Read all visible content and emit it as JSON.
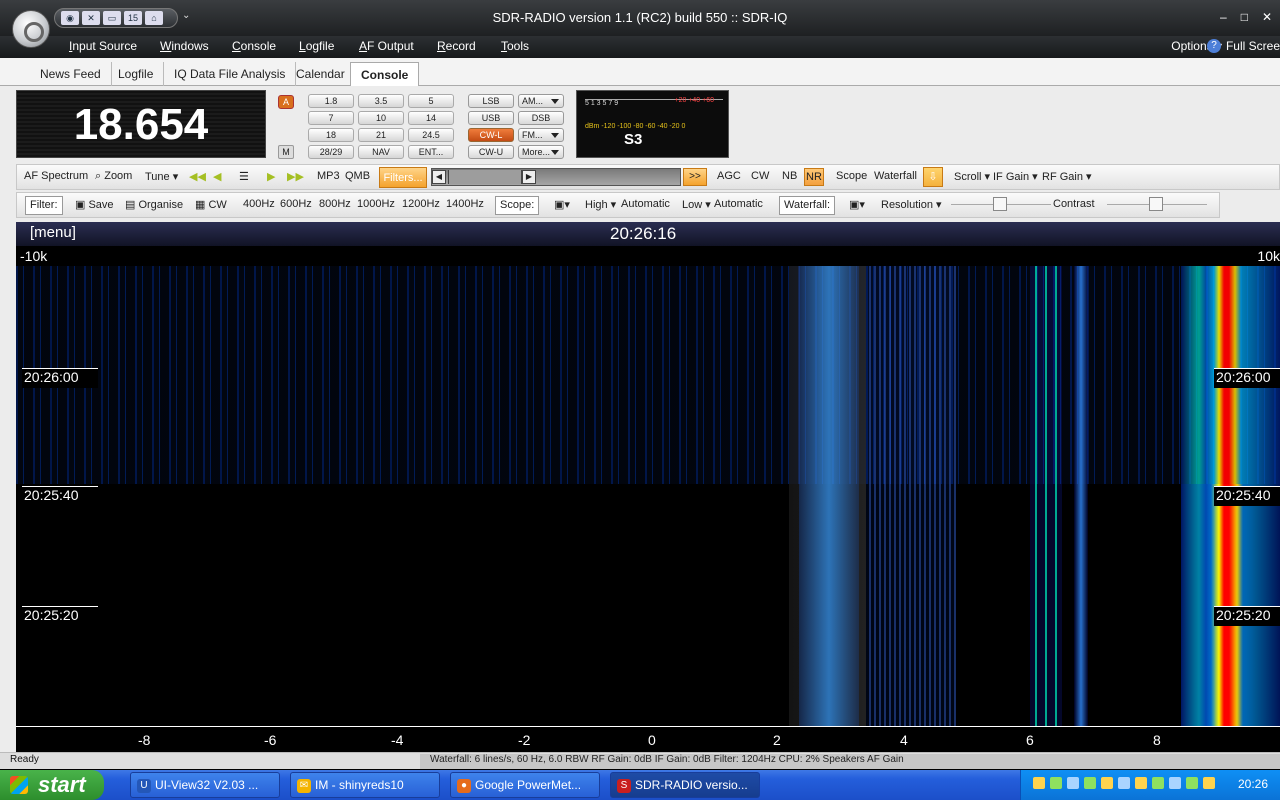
{
  "window": {
    "title": "SDR-RADIO version 1.1 (RC2) build 550 :: SDR-IQ",
    "controls": [
      "–",
      "□",
      "✕"
    ]
  },
  "quick_access": {
    "icons": [
      "camera-icon",
      "tools-icon",
      "monitor-icon",
      "calendar-icon",
      "home-icon"
    ],
    "calendar_text": "15",
    "more": "⌄"
  },
  "menu": {
    "items": [
      "Input Source",
      "Windows",
      "Console",
      "Logfile",
      "AF Output",
      "Record",
      "Tools"
    ],
    "options": "Options ▾",
    "full": "Full Scree"
  },
  "tabs": [
    "News Feed",
    "Logfile",
    "IQ Data File Analysis",
    "Calendar",
    "Console"
  ],
  "frequency": "18.654",
  "badges": {
    "a": "A",
    "m": "M"
  },
  "bands": [
    "1.8",
    "3.5",
    "5",
    "7",
    "10",
    "14",
    "18",
    "21",
    "24.5",
    "28/29",
    "NAV",
    "ENT..."
  ],
  "modes": [
    "LSB",
    "USB",
    "CW-L",
    "CW-U",
    "DSB"
  ],
  "mode_dropdowns": [
    "AM...",
    "FM...",
    "More..."
  ],
  "smeter": {
    "top_scale": "5 1 3 5 7 9",
    "red_scale": "+20 +40 +60",
    "dbm": "dBm -120 -100 -80 -60 -40 -20 0",
    "reading": "S3"
  },
  "toolbar1": {
    "af_spectrum": "AF Spectrum",
    "zoom": "Zoom",
    "tune": "Tune ▾",
    "mp3": "MP3",
    "qmb": "QMB",
    "filters": "Filters...",
    "fast": ">>",
    "agc": "AGC",
    "cw": "CW",
    "nb": "NB",
    "nr": "NR",
    "scope": "Scope",
    "waterfall": "Waterfall",
    "scroll": "Scroll ▾",
    "if_gain": "IF Gain ▾",
    "rf_gain": "RF Gain ▾"
  },
  "toolbar2": {
    "filter": "Filter:",
    "save": "Save",
    "organise": "Organise",
    "cw": "CW",
    "widths": [
      "400Hz",
      "600Hz",
      "800Hz",
      "1000Hz",
      "1200Hz",
      "1400Hz"
    ],
    "scope": "Scope:",
    "high": "High ▾",
    "automatic": "Automatic",
    "low": "Low ▾",
    "automatic2": "Automatic",
    "waterfall": "Waterfall:",
    "resolution": "Resolution ▾",
    "contrast": "Contrast"
  },
  "display": {
    "menu": "[menu]",
    "clock": "20:26:16",
    "left_scale": "-10k",
    "right_scale": "10k",
    "times": [
      "20:26:00",
      "20:25:40",
      "20:25:20"
    ],
    "axis": [
      "-8",
      "-6",
      "-4",
      "-2",
      "0",
      "2",
      "4",
      "6",
      "8"
    ]
  },
  "status": {
    "ready": "Ready",
    "info": "Waterfall: 6 lines/s, 60 Hz, 6.0 RBW    RF Gain: 0dB    IF Gain: 0dB    Filter: 1204Hz    CPU: 2%      Speakers      AF Gain"
  },
  "taskbar": {
    "start": "start",
    "tasks": [
      "UI-View32 V2.03 ...",
      "IM - shinyreds10",
      "Google PowerMet...",
      "SDR-RADIO versio..."
    ],
    "clock": "20:26"
  }
}
